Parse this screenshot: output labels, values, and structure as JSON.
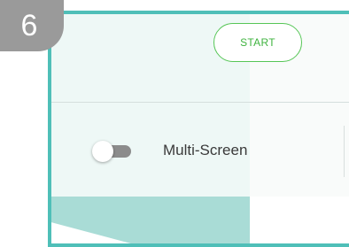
{
  "badge": {
    "step_number": "6"
  },
  "toolbar": {
    "start_label": "START"
  },
  "settings": {
    "multi_screen": {
      "label": "Multi-Screen",
      "enabled": false
    }
  },
  "colors": {
    "accent_teal": "#4fbfb8",
    "start_green": "#3fb33f",
    "badge_gray": "#9a9a9a",
    "toggle_off": "#8c8c8c"
  }
}
